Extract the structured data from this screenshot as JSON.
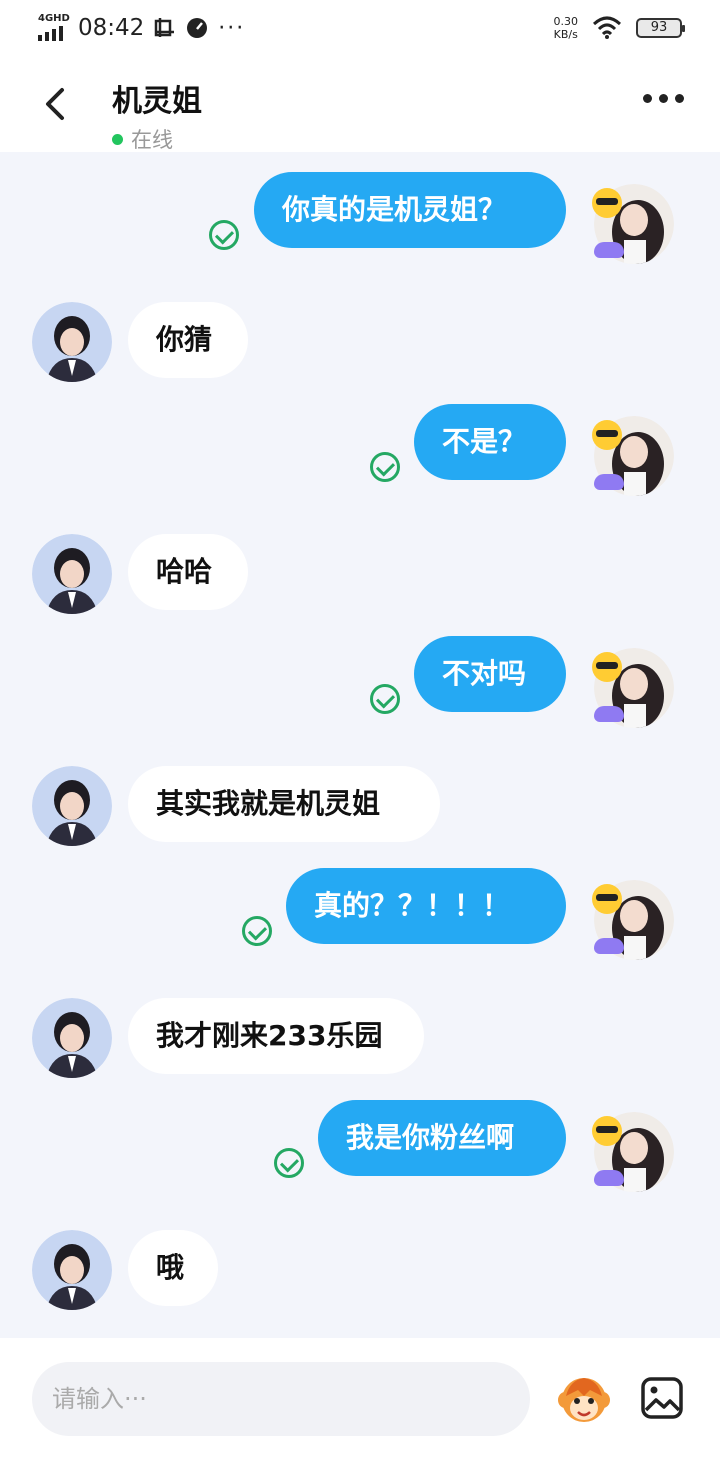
{
  "status_bar": {
    "network": "4GHD",
    "time": "08:42",
    "speed_value": "0.30",
    "speed_unit": "KB/s",
    "battery": "93",
    "dots": "···"
  },
  "header": {
    "title": "机灵姐",
    "status": "在线"
  },
  "messages": [
    {
      "from": "me",
      "text": "你真的是机灵姐？"
    },
    {
      "from": "other",
      "text": "你猜"
    },
    {
      "from": "me",
      "text": "不是？"
    },
    {
      "from": "other",
      "text": "哈哈"
    },
    {
      "from": "me",
      "text": "不对吗"
    },
    {
      "from": "other",
      "text": "其实我就是机灵姐"
    },
    {
      "from": "me",
      "text": "真的？？！！！"
    },
    {
      "from": "other",
      "text": "我才刚来233乐园"
    },
    {
      "from": "me",
      "text": "我是你粉丝啊"
    },
    {
      "from": "other",
      "text": "哦"
    }
  ],
  "input": {
    "placeholder": "请输入···"
  },
  "colors": {
    "my_bubble": "#25a9f3",
    "other_bubble": "#ffffff",
    "read_check": "#24a863",
    "online_dot": "#22c55e",
    "background": "#f3f5fb"
  },
  "icons": {
    "back": "chevron-left-icon",
    "more": "more-dots-icon",
    "read": "check-circle-icon",
    "emoji": "monkey-emoji-icon",
    "image": "image-icon"
  }
}
